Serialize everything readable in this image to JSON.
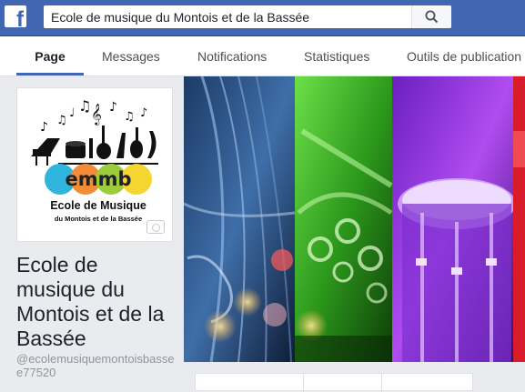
{
  "search": {
    "value": "Ecole de musique du Montois et de la Bassée"
  },
  "tabs": [
    {
      "label": "Page"
    },
    {
      "label": "Messages"
    },
    {
      "label": "Notifications"
    },
    {
      "label": "Statistiques"
    },
    {
      "label": "Outils de publication"
    }
  ],
  "profile": {
    "logo": {
      "acronym": "emmb",
      "line1": "Ecole de Musique",
      "line2": "du Montois et de la Bassée"
    },
    "name": "Ecole de musique du Montois et de la Bassée",
    "handle": "@ecolemusiquemontoisbassee77520"
  },
  "colors": {
    "brand": "#4267b2",
    "tab_active_border": "#4267b2"
  }
}
